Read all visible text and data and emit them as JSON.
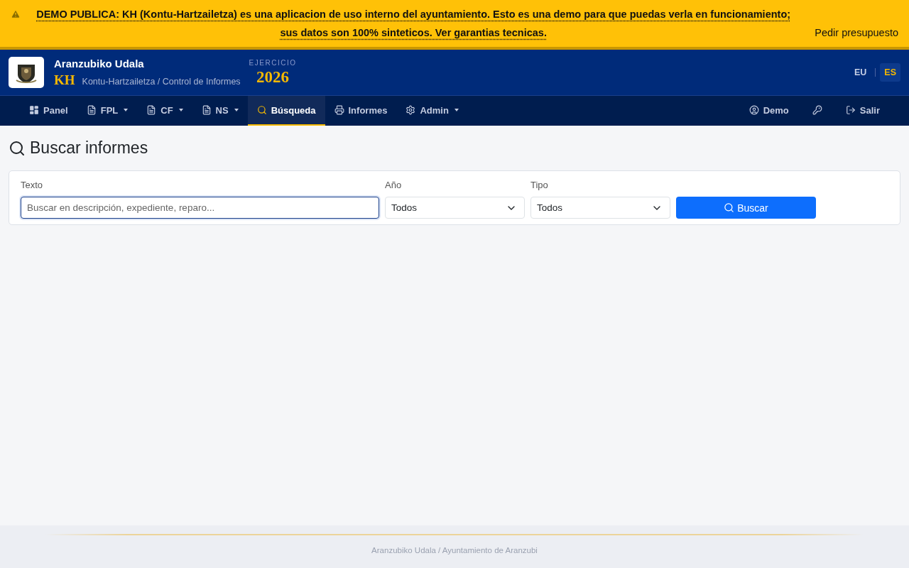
{
  "banner": {
    "notice": "DEMO PUBLICA: KH (Kontu-Hartzailetza) es una aplicacion de uso interno del ayuntamiento. Esto es una demo para que puedas verla en funcionamiento; sus datos son 100% sinteticos. Ver garantias tecnicas.",
    "action": "Pedir presupuesto"
  },
  "header": {
    "org": "Aranzubiko Udala",
    "app_short": "KH",
    "app_name": "Kontu-Hartzailetza / Control de Informes",
    "year_label": "EJERCICIO",
    "year": "2026",
    "languages": [
      {
        "label": "EU",
        "selected": false
      },
      {
        "label": "ES",
        "selected": true
      }
    ]
  },
  "nav": {
    "items": [
      {
        "label": "Panel",
        "kind": "panel",
        "has_menu": false,
        "selected": false
      },
      {
        "label": "FPL",
        "kind": "doc",
        "has_menu": true,
        "selected": false
      },
      {
        "label": "CF",
        "kind": "doc",
        "has_menu": true,
        "selected": false
      },
      {
        "label": "NS",
        "kind": "doc",
        "has_menu": true,
        "selected": false
      },
      {
        "label": "Búsqueda",
        "kind": "search",
        "has_menu": false,
        "selected": true
      },
      {
        "label": "Informes",
        "kind": "print",
        "has_menu": false,
        "selected": false
      },
      {
        "label": "Admin",
        "kind": "gear",
        "has_menu": true,
        "selected": false
      }
    ],
    "user": "Demo",
    "logout": "Salir"
  },
  "page": {
    "title": "Buscar informes",
    "filters": {
      "text_label": "Texto",
      "text_placeholder": "Buscar en descripción, expediente, reparo...",
      "year_label": "Año",
      "year_value": "Todos",
      "type_label": "Tipo",
      "type_value": "Todos",
      "submit": "Buscar"
    }
  },
  "footer": "Aranzubiko Udala / Ayuntamiento de Aranzubi"
}
